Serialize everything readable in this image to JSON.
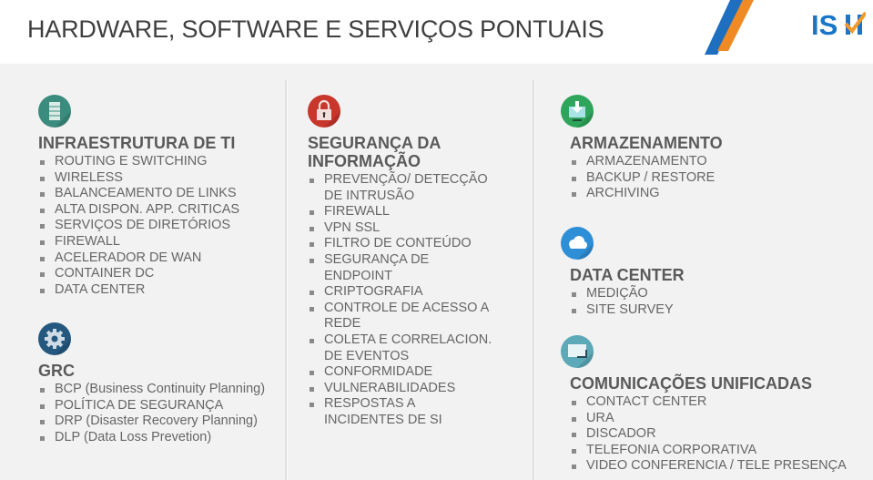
{
  "page": {
    "title": "HARDWARE, SOFTWARE E SERVIÇOS PONTUAIS",
    "logo_text": "ISH",
    "colors": {
      "stripe_blue": "#1f6fc0",
      "stripe_orange": "#f08a24",
      "logo_blue": "#1a75c7",
      "logo_check": "#f29a2e"
    }
  },
  "sections": {
    "infra": {
      "icon": "server-icon",
      "color": "#3a8c7e",
      "title": "INFRAESTRUTURA DE TI",
      "items": [
        "ROUTING E SWITCHING",
        "WIRELESS",
        "BALANCEAMENTO DE LINKS",
        "ALTA DISPON. APP. CRITICAS",
        "SERVIÇOS DE DIRETÓRIOS",
        "FIREWALL",
        "ACELERADOR DE WAN",
        "CONTAINER DC",
        "DATA CENTER"
      ]
    },
    "grc": {
      "icon": "gear-icon",
      "color": "#24587f",
      "title": "GRC",
      "items": [
        "BCP (Business Continuity Planning)",
        "POLÍTICA DE SEGURANÇA",
        "DRP (Disaster Recovery Planning)",
        "DLP (Data Loss Prevetion)"
      ]
    },
    "security": {
      "icon": "lock-icon",
      "color": "#c8362c",
      "title_line1": "SEGURANÇA DA",
      "title_line2": "INFORMAÇÃO",
      "items": [
        "PREVENÇÃO/ DETECÇÃO DE INTRUSÃO",
        "FIREWALL",
        "VPN SSL",
        "FILTRO DE CONTEÚDO",
        "SEGURANÇA DE ENDPOINT",
        "CRIPTOGRAFIA",
        "CONTROLE DE ACESSO A REDE",
        "COLETA E CORRELACION. DE EVENTOS",
        "CONFORMIDADE",
        "VULNERABILIDADES",
        "RESPOSTAS A INCIDENTES DE SI"
      ]
    },
    "storage": {
      "icon": "download-monitor-icon",
      "color": "#2ea55a",
      "title": "ARMAZENAMENTO",
      "items": [
        "ARMAZENAMENTO",
        "BACKUP / RESTORE",
        "ARCHIVING"
      ]
    },
    "datacenter": {
      "icon": "cloud-icon",
      "color": "#2f8fd6",
      "title": "DATA CENTER",
      "items": [
        "MEDIÇÃO",
        "SITE SURVEY"
      ]
    },
    "uc": {
      "icon": "chat-bubble-icon",
      "color": "#5ca9b8",
      "title": "COMUNICAÇÕES UNIFICADAS",
      "items": [
        "CONTACT CENTER",
        "URA",
        "DISCADOR",
        "TELEFONIA CORPORATIVA",
        "VIDEO CONFERENCIA / TELE PRESENÇA"
      ]
    }
  }
}
